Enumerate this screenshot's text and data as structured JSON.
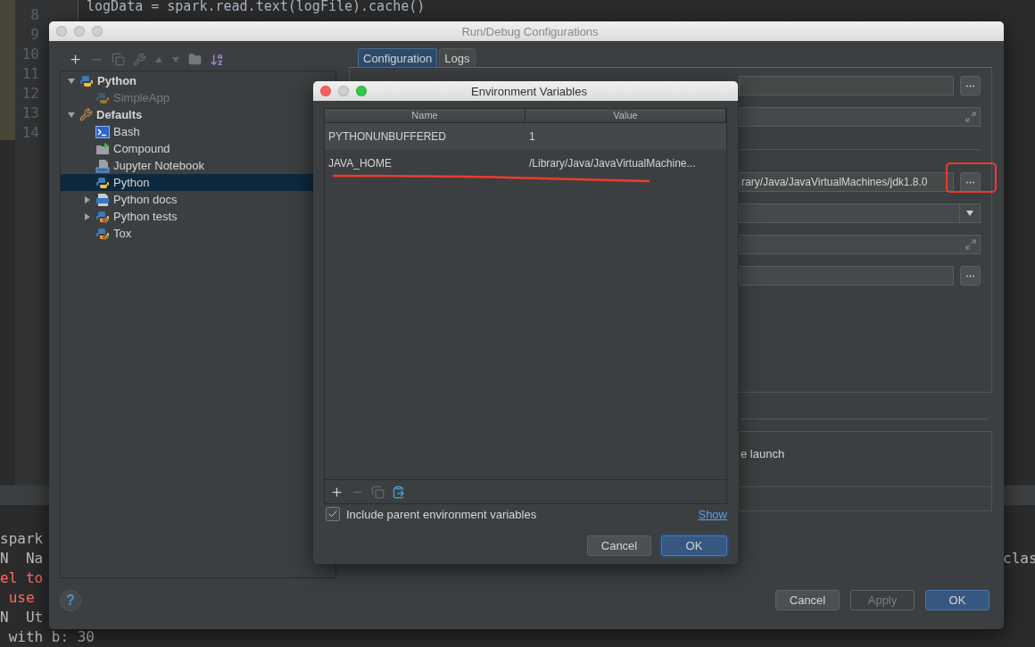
{
  "editor": {
    "code_lines": [
      "logData = spark.read.text(logFile).cache()"
    ],
    "line_numbers": [
      "8",
      "9",
      "10",
      "11",
      "12",
      "13",
      "14"
    ]
  },
  "console": {
    "lines": [
      {
        "text": "spark",
        "kind": "info"
      },
      {
        "text": "N  Na",
        "kind": "info",
        "right_text": "clas"
      },
      {
        "text": "el to",
        "kind": "error"
      },
      {
        "text": " use",
        "kind": "error"
      },
      {
        "text": "N  Ut",
        "kind": "info"
      },
      {
        "text": " with b: 30",
        "kind": "info"
      }
    ]
  },
  "run_dialog": {
    "title": "Run/Debug Configurations",
    "tree": [
      {
        "label": "Python",
        "kind": "python",
        "bold": true,
        "selected": false,
        "disabled": false,
        "expanded": true,
        "children": [
          {
            "label": "SimpleApp",
            "kind": "python",
            "bold": false,
            "selected": false,
            "disabled": true
          }
        ]
      },
      {
        "label": "Defaults",
        "kind": "defaults",
        "bold": true,
        "selected": false,
        "disabled": false,
        "expanded": true,
        "children": [
          {
            "label": "Bash",
            "kind": "bash",
            "bold": false,
            "selected": false,
            "disabled": false
          },
          {
            "label": "Compound",
            "kind": "compound",
            "bold": false,
            "selected": false,
            "disabled": false
          },
          {
            "label": "Jupyter Notebook",
            "kind": "jupyter",
            "bold": false,
            "selected": false,
            "disabled": false
          },
          {
            "label": "Python",
            "kind": "python",
            "bold": false,
            "selected": true,
            "disabled": false
          },
          {
            "label": "Python docs",
            "kind": "rst",
            "bold": false,
            "selected": false,
            "disabled": false,
            "expanded": false
          },
          {
            "label": "Python tests",
            "kind": "pytest",
            "bold": false,
            "selected": false,
            "disabled": false,
            "expanded": false
          },
          {
            "label": "Tox",
            "kind": "pytest",
            "bold": false,
            "selected": false,
            "disabled": false
          }
        ]
      }
    ],
    "tabs": [
      {
        "label": "Configuration",
        "selected": true
      },
      {
        "label": "Logs",
        "selected": false
      }
    ],
    "fields": [
      {
        "kind": "browse"
      },
      {
        "kind": "expand"
      },
      {
        "kind": "separator"
      },
      {
        "kind": "browse",
        "value": "rary/Java/JavaVirtualMachines/jdk1.8.0"
      },
      {
        "kind": "dropdown"
      },
      {
        "kind": "expand"
      },
      {
        "kind": "browse"
      }
    ],
    "launch_text": "e launch",
    "help": "?",
    "buttons": [
      {
        "label": "Cancel",
        "disabled": false,
        "default": false
      },
      {
        "label": "Apply",
        "disabled": true,
        "default": false
      },
      {
        "label": "OK",
        "disabled": false,
        "default": true
      }
    ]
  },
  "env_dialog": {
    "title": "Environment Variables",
    "columns": [
      "Name",
      "Value"
    ],
    "rows": [
      {
        "name": "PYTHONUNBUFFERED",
        "value": "1"
      },
      {
        "name": "JAVA_HOME",
        "value": "/Library/Java/JavaVirtualMachine..."
      }
    ],
    "include_parent": {
      "label": "Include parent environment variables",
      "checked": true
    },
    "show_link": "Show",
    "buttons": [
      {
        "label": "Cancel",
        "disabled": false,
        "default": false
      },
      {
        "label": "OK",
        "disabled": false,
        "default": true
      }
    ]
  }
}
